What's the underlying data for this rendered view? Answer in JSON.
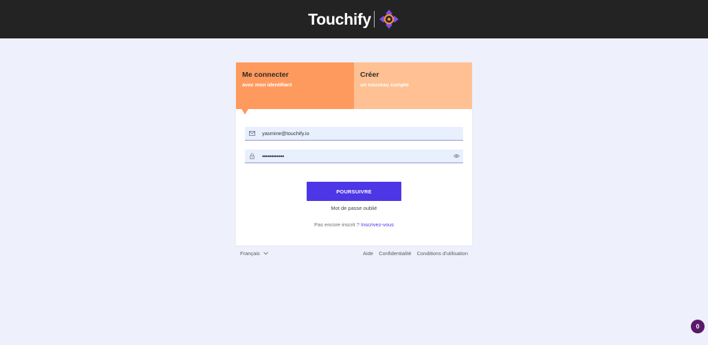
{
  "brand": {
    "name": "Touchify"
  },
  "tabs": [
    {
      "title": "Me connecter",
      "subtitle": "avec mon identifiant",
      "active": true
    },
    {
      "title": "Créer",
      "subtitle": "un nouveau compte",
      "active": false
    }
  ],
  "form": {
    "email": {
      "value": "yasmine@touchify.io",
      "icon": "mail-icon"
    },
    "password": {
      "value": "••••••••••••",
      "icon": "lock-icon",
      "toggle_icon": "eye-icon"
    },
    "submit_label": "POURSUIVRE",
    "forgot_label": "Mot de passe oublié",
    "signup_prompt": "Pas encore inscrit ?",
    "signup_link": "Inscrivez-vous"
  },
  "footer": {
    "language": "Français",
    "links": [
      "Aide",
      "Confidentialité",
      "Conditions d'utilisation"
    ]
  },
  "notification": {
    "count": "0"
  },
  "colors": {
    "topbar": "#232323",
    "background": "#eef0fb",
    "tab_active": "#ff9a5e",
    "tab_inactive": "#ffc193",
    "primary": "#4c36e6",
    "field_bg": "#e8effd",
    "badge": "#5a1a6a"
  }
}
